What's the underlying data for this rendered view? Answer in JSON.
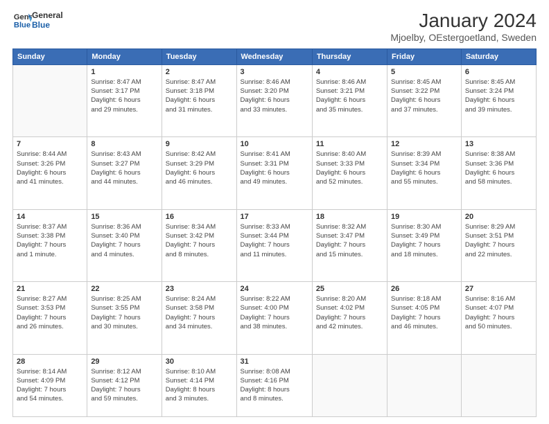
{
  "header": {
    "logo_line1": "General",
    "logo_line2": "Blue",
    "title": "January 2024",
    "subtitle": "Mjoelby, OEstergoetland, Sweden"
  },
  "weekdays": [
    "Sunday",
    "Monday",
    "Tuesday",
    "Wednesday",
    "Thursday",
    "Friday",
    "Saturday"
  ],
  "weeks": [
    [
      {
        "day": "",
        "info": ""
      },
      {
        "day": "1",
        "info": "Sunrise: 8:47 AM\nSunset: 3:17 PM\nDaylight: 6 hours\nand 29 minutes."
      },
      {
        "day": "2",
        "info": "Sunrise: 8:47 AM\nSunset: 3:18 PM\nDaylight: 6 hours\nand 31 minutes."
      },
      {
        "day": "3",
        "info": "Sunrise: 8:46 AM\nSunset: 3:20 PM\nDaylight: 6 hours\nand 33 minutes."
      },
      {
        "day": "4",
        "info": "Sunrise: 8:46 AM\nSunset: 3:21 PM\nDaylight: 6 hours\nand 35 minutes."
      },
      {
        "day": "5",
        "info": "Sunrise: 8:45 AM\nSunset: 3:22 PM\nDaylight: 6 hours\nand 37 minutes."
      },
      {
        "day": "6",
        "info": "Sunrise: 8:45 AM\nSunset: 3:24 PM\nDaylight: 6 hours\nand 39 minutes."
      }
    ],
    [
      {
        "day": "7",
        "info": "Sunrise: 8:44 AM\nSunset: 3:26 PM\nDaylight: 6 hours\nand 41 minutes."
      },
      {
        "day": "8",
        "info": "Sunrise: 8:43 AM\nSunset: 3:27 PM\nDaylight: 6 hours\nand 44 minutes."
      },
      {
        "day": "9",
        "info": "Sunrise: 8:42 AM\nSunset: 3:29 PM\nDaylight: 6 hours\nand 46 minutes."
      },
      {
        "day": "10",
        "info": "Sunrise: 8:41 AM\nSunset: 3:31 PM\nDaylight: 6 hours\nand 49 minutes."
      },
      {
        "day": "11",
        "info": "Sunrise: 8:40 AM\nSunset: 3:33 PM\nDaylight: 6 hours\nand 52 minutes."
      },
      {
        "day": "12",
        "info": "Sunrise: 8:39 AM\nSunset: 3:34 PM\nDaylight: 6 hours\nand 55 minutes."
      },
      {
        "day": "13",
        "info": "Sunrise: 8:38 AM\nSunset: 3:36 PM\nDaylight: 6 hours\nand 58 minutes."
      }
    ],
    [
      {
        "day": "14",
        "info": "Sunrise: 8:37 AM\nSunset: 3:38 PM\nDaylight: 7 hours\nand 1 minute."
      },
      {
        "day": "15",
        "info": "Sunrise: 8:36 AM\nSunset: 3:40 PM\nDaylight: 7 hours\nand 4 minutes."
      },
      {
        "day": "16",
        "info": "Sunrise: 8:34 AM\nSunset: 3:42 PM\nDaylight: 7 hours\nand 8 minutes."
      },
      {
        "day": "17",
        "info": "Sunrise: 8:33 AM\nSunset: 3:44 PM\nDaylight: 7 hours\nand 11 minutes."
      },
      {
        "day": "18",
        "info": "Sunrise: 8:32 AM\nSunset: 3:47 PM\nDaylight: 7 hours\nand 15 minutes."
      },
      {
        "day": "19",
        "info": "Sunrise: 8:30 AM\nSunset: 3:49 PM\nDaylight: 7 hours\nand 18 minutes."
      },
      {
        "day": "20",
        "info": "Sunrise: 8:29 AM\nSunset: 3:51 PM\nDaylight: 7 hours\nand 22 minutes."
      }
    ],
    [
      {
        "day": "21",
        "info": "Sunrise: 8:27 AM\nSunset: 3:53 PM\nDaylight: 7 hours\nand 26 minutes."
      },
      {
        "day": "22",
        "info": "Sunrise: 8:25 AM\nSunset: 3:55 PM\nDaylight: 7 hours\nand 30 minutes."
      },
      {
        "day": "23",
        "info": "Sunrise: 8:24 AM\nSunset: 3:58 PM\nDaylight: 7 hours\nand 34 minutes."
      },
      {
        "day": "24",
        "info": "Sunrise: 8:22 AM\nSunset: 4:00 PM\nDaylight: 7 hours\nand 38 minutes."
      },
      {
        "day": "25",
        "info": "Sunrise: 8:20 AM\nSunset: 4:02 PM\nDaylight: 7 hours\nand 42 minutes."
      },
      {
        "day": "26",
        "info": "Sunrise: 8:18 AM\nSunset: 4:05 PM\nDaylight: 7 hours\nand 46 minutes."
      },
      {
        "day": "27",
        "info": "Sunrise: 8:16 AM\nSunset: 4:07 PM\nDaylight: 7 hours\nand 50 minutes."
      }
    ],
    [
      {
        "day": "28",
        "info": "Sunrise: 8:14 AM\nSunset: 4:09 PM\nDaylight: 7 hours\nand 54 minutes."
      },
      {
        "day": "29",
        "info": "Sunrise: 8:12 AM\nSunset: 4:12 PM\nDaylight: 7 hours\nand 59 minutes."
      },
      {
        "day": "30",
        "info": "Sunrise: 8:10 AM\nSunset: 4:14 PM\nDaylight: 8 hours\nand 3 minutes."
      },
      {
        "day": "31",
        "info": "Sunrise: 8:08 AM\nSunset: 4:16 PM\nDaylight: 8 hours\nand 8 minutes."
      },
      {
        "day": "",
        "info": ""
      },
      {
        "day": "",
        "info": ""
      },
      {
        "day": "",
        "info": ""
      }
    ]
  ]
}
